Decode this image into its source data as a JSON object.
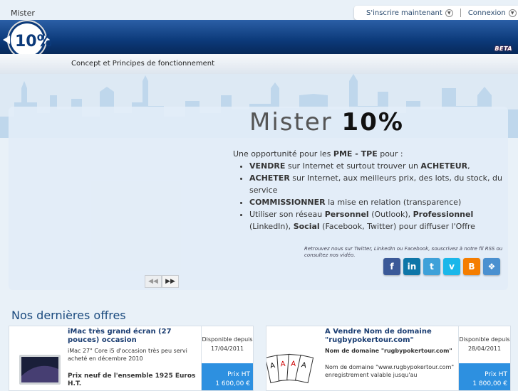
{
  "header": {
    "logo_text": "Mister",
    "logo_number": "10%",
    "signup_label": "S'inscrire maintenant",
    "login_label": "Connexion",
    "beta_label": "BETA"
  },
  "nav": {
    "item_concept": "Concept et Principes de fonctionnement"
  },
  "hero": {
    "title_word": "Mister",
    "title_number": "10%",
    "intro_text": "Une opportunité pour les",
    "intro_bold": "PME - TPE",
    "intro_tail": "pour :",
    "bullets": [
      {
        "bold": "VENDRE",
        "text": " sur Internet et surtout trouver un ",
        "bold2": "ACHETEUR",
        "text2": ","
      },
      {
        "bold": "ACHETER",
        "text": " sur Internet, aux meilleurs prix, des lots, du stock, du service"
      },
      {
        "bold": "COMMISSIONNER",
        "text": " la mise en relation (transparence)"
      },
      {
        "pre": "Utiliser son réseau ",
        "bold": "Personnel",
        "text": " (Outlook), ",
        "bold2": "Professionnel",
        "text2": " (LinkedIn), ",
        "bold3": "Social",
        "text3": " (Facebook, Twitter) pour diffuser l'Offre"
      }
    ],
    "rss_note": "Retrouvez nous sur Twitter, LinkedIn ou Facebook, souscrivez à notre fil RSS ou consultez nos vidéo."
  },
  "social_icons": [
    {
      "name": "facebook-icon",
      "glyph": "f",
      "color": "#3b5998"
    },
    {
      "name": "linkedin-icon",
      "glyph": "in",
      "color": "#0e76a8"
    },
    {
      "name": "twitter-icon",
      "glyph": "t",
      "color": "#3ea1d9"
    },
    {
      "name": "vimeo-icon",
      "glyph": "v",
      "color": "#1ab7ea"
    },
    {
      "name": "blogger-icon",
      "glyph": "B",
      "color": "#f57d00"
    },
    {
      "name": "delicious-icon",
      "glyph": "❖",
      "color": "#4a90d0"
    }
  ],
  "pager": {
    "prev": "◀◀",
    "next": "▶▶"
  },
  "offers": {
    "section_title": "Nos dernières offres",
    "items": [
      {
        "title": "iMac très grand écran (27 pouces) occasion",
        "desc": "iMac 27\" Core i5 d'occasion très peu servi acheté en décembre 2010",
        "extra": "Prix neuf de l'ensemble 1925 Euros H.T.",
        "avail_label": "Disponible depuis",
        "avail_date": "17/04/2011",
        "price_label": "Prix HT",
        "price": "1 600,00 €"
      },
      {
        "title": "A Vendre Nom de domaine \"rugbypokertour.com\"",
        "desc": "Nom de domaine \"rugbypokertour.com\"",
        "extra": "Nom de domaine \"www.rugbypokertour.com\" enregistrement valable jusqu'au",
        "avail_label": "Disponible depuis",
        "avail_date": "28/04/2011",
        "price_label": "Prix HT",
        "price": "1 800,00 €"
      }
    ]
  }
}
